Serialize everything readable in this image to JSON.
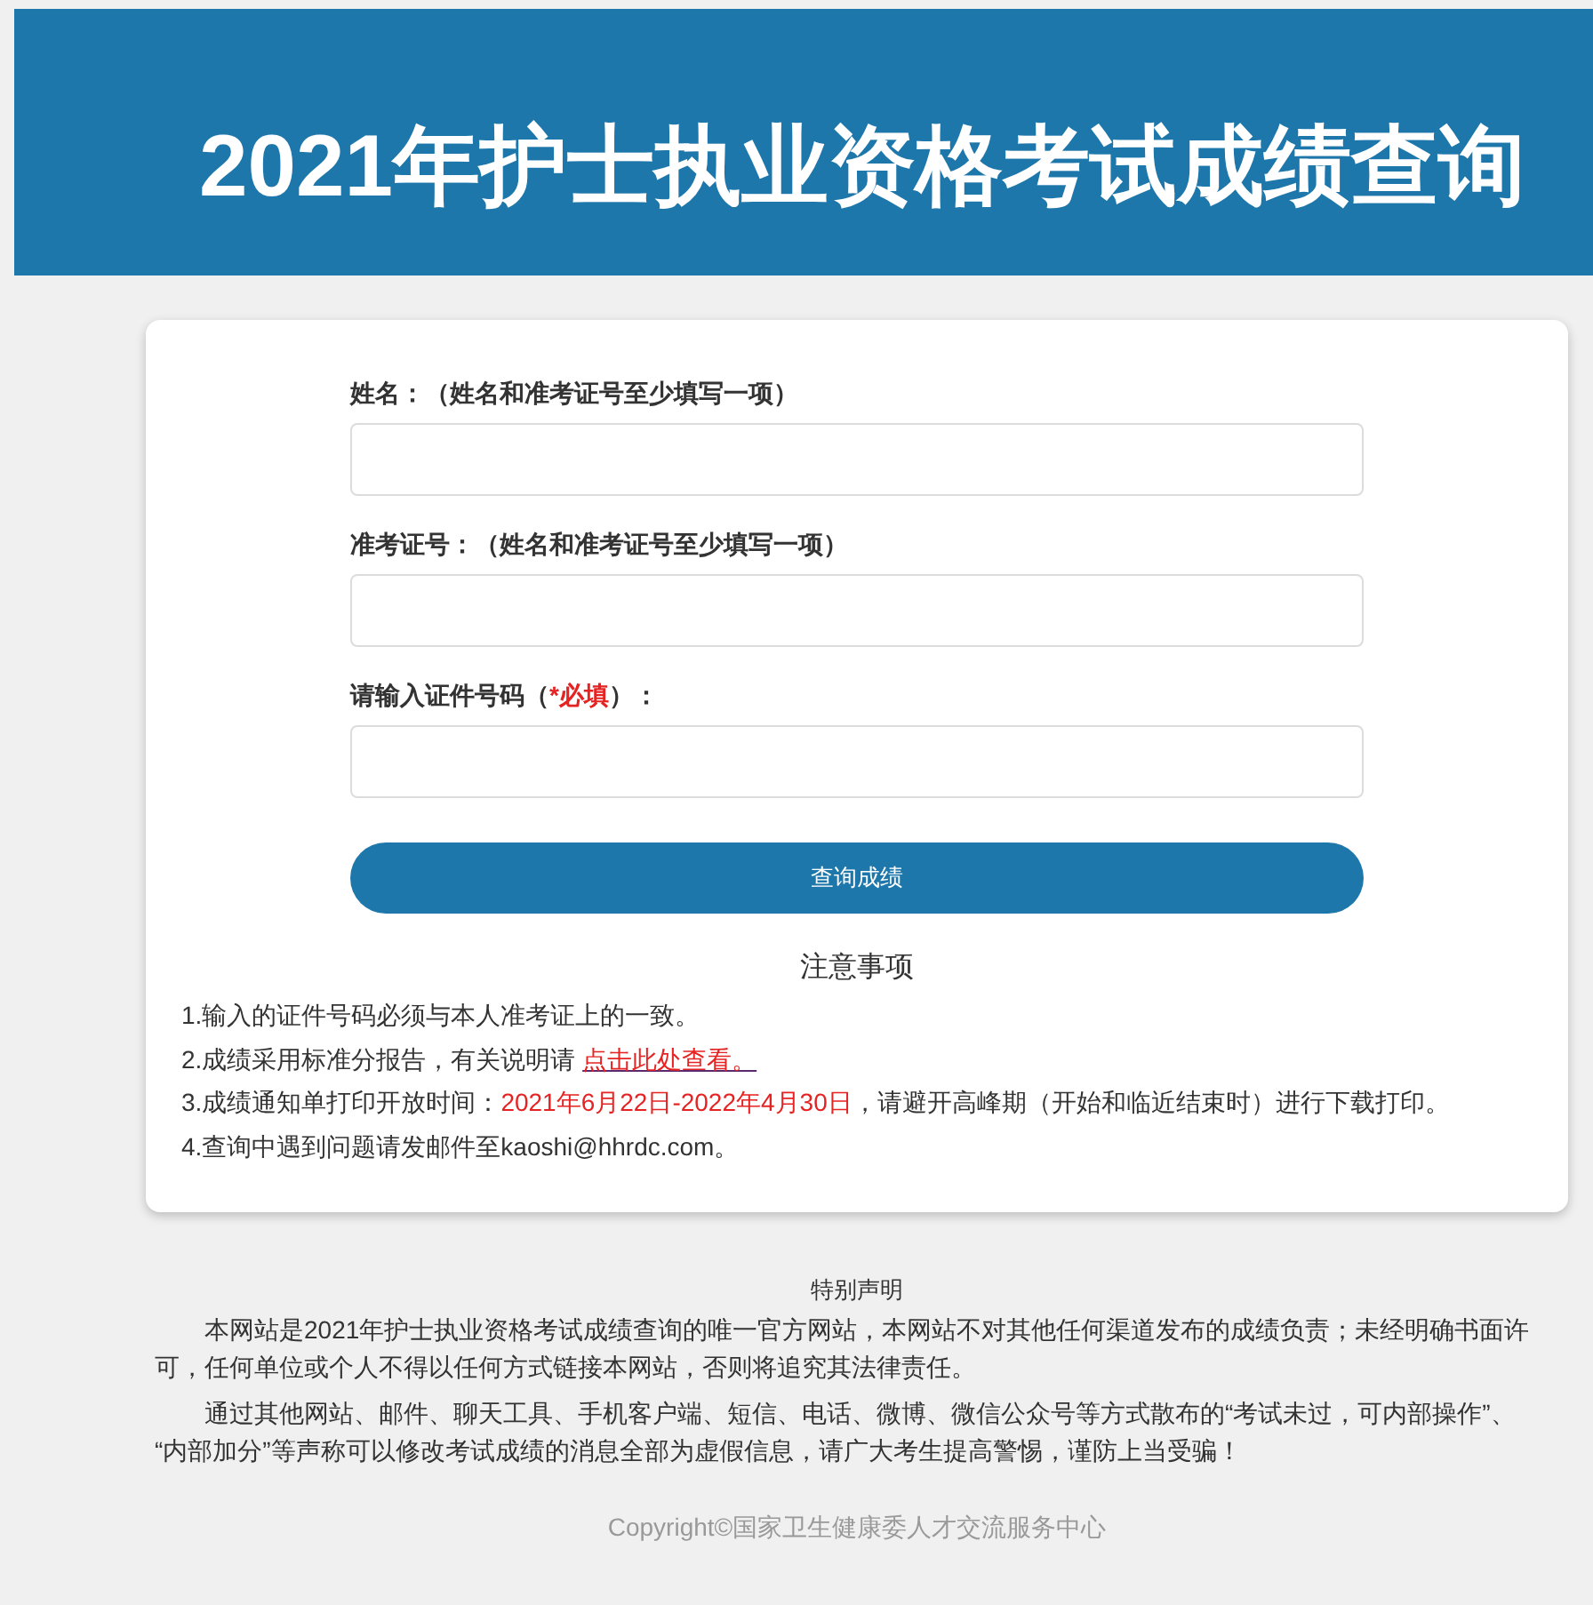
{
  "header": {
    "title": "2021年护士执业资格考试成绩查询"
  },
  "form": {
    "fields": [
      {
        "label": [
          {
            "kind": "text",
            "text": "姓名：（姓名和准考证号至少填写一项）"
          }
        ]
      },
      {
        "label": [
          {
            "kind": "text",
            "text": "准考证号：（姓名和准考证号至少填写一项）"
          }
        ]
      },
      {
        "label": [
          {
            "kind": "text",
            "text": "请输入证件号码（"
          },
          {
            "kind": "required",
            "text": "*必填"
          },
          {
            "kind": "text",
            "text": "）："
          }
        ]
      }
    ],
    "submit_button": "查询成绩"
  },
  "notes": {
    "title": "注意事项",
    "items": [
      {
        "parts": [
          {
            "kind": "text",
            "text": "1.输入的证件号码必须与本人准考证上的一致。"
          }
        ]
      },
      {
        "parts": [
          {
            "kind": "text",
            "text": "2.成绩采用标准分报告，有关说明请 "
          },
          {
            "kind": "link",
            "text": "点击此处查看。"
          }
        ]
      },
      {
        "parts": [
          {
            "kind": "text",
            "text": "3.成绩通知单打印开放时间："
          },
          {
            "kind": "highlight",
            "text": "2021年6月22日-2022年4月30日"
          },
          {
            "kind": "text",
            "text": "，请避开高峰期（开始和临近结束时）进行下载打印。"
          }
        ]
      },
      {
        "parts": [
          {
            "kind": "text",
            "text": "4.查询中遇到问题请发邮件至kaoshi@hhrdc.com。"
          }
        ]
      }
    ]
  },
  "statement": {
    "title": "特别声明",
    "paragraphs": [
      "本网站是2021年护士执业资格考试成绩查询的唯一官方网站，本网站不对其他任何渠道发布的成绩负责；未经明确书面许可，任何单位或个人不得以任何方式链接本网站，否则将追究其法律责任。",
      "通过其他网站、邮件、聊天工具、手机客户端、短信、电话、微博、微信公众号等方式散布的“考试未过，可内部操作”、“内部加分”等声称可以修改考试成绩的消息全部为虚假信息，请广大考生提高警惕，谨防上当受骗！"
    ]
  },
  "footer": {
    "copyright": "Copyright©国家卫生健康委人才交流服务中心"
  }
}
